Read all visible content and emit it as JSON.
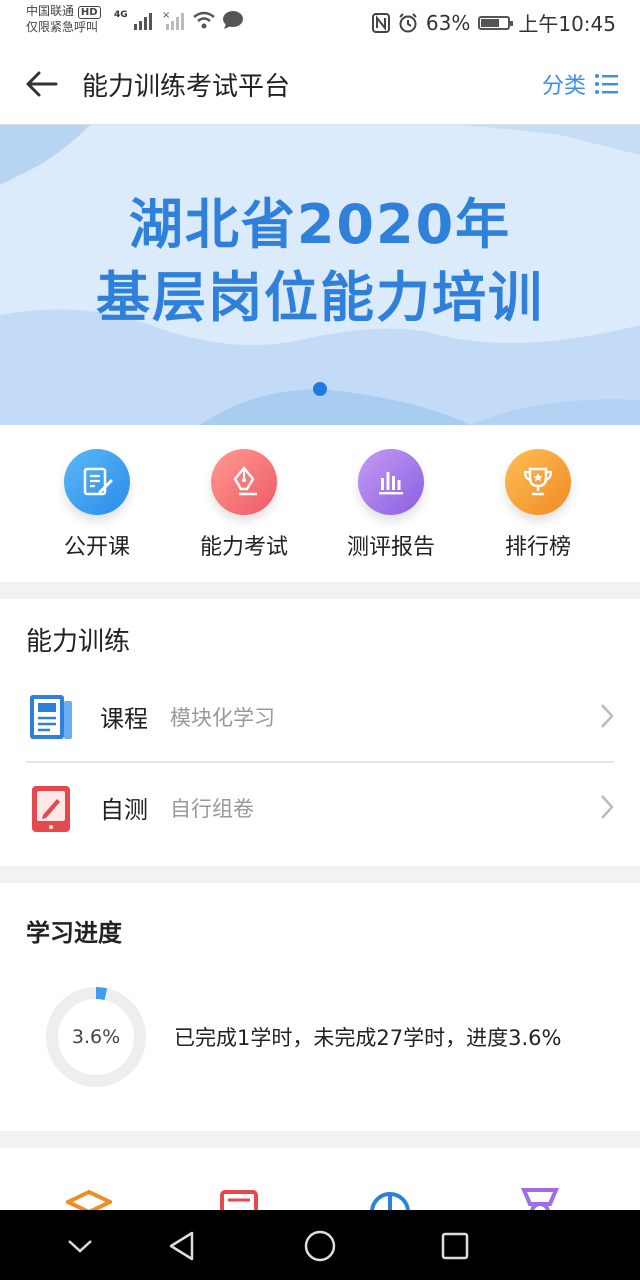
{
  "status": {
    "carrier_line1": "中国联通",
    "carrier_hd": "HD",
    "carrier_line2": "仅限紧急呼叫",
    "net": "4G",
    "battery": "63%",
    "battery_level": 0.63,
    "time": "上午10:45"
  },
  "header": {
    "title": "能力训练考试平台",
    "category_label": "分类"
  },
  "banner": {
    "line1": "湖北省2020年",
    "line2": "基层岗位能力培训",
    "slide_count": 1,
    "active_slide": 1
  },
  "quick_menu": [
    {
      "label": "公开课",
      "icon": "notebook-pen-icon",
      "color": "#3a9eee"
    },
    {
      "label": "能力考试",
      "icon": "pen-nib-icon",
      "color": "#f26a6a"
    },
    {
      "label": "测评报告",
      "icon": "bar-chart-icon",
      "color": "#a06be8"
    },
    {
      "label": "排行榜",
      "icon": "trophy-icon",
      "color": "#f39a33"
    }
  ],
  "training": {
    "title": "能力训练",
    "items": [
      {
        "main": "课程",
        "sub": "模块化学习",
        "icon": "document-icon",
        "color": "#2f80db"
      },
      {
        "main": "自测",
        "sub": "自行组卷",
        "icon": "tablet-pencil-icon",
        "color": "#e5484d"
      }
    ]
  },
  "progress": {
    "title": "学习进度",
    "percent_text": "3.6%",
    "percent": 3.6,
    "description": "已完成1学时，未完成27学时，进度3.6%"
  },
  "colors": {
    "accent": "#3e8ee8",
    "banner_text": "#2f80db",
    "banner_bg": "#dcebfb"
  }
}
